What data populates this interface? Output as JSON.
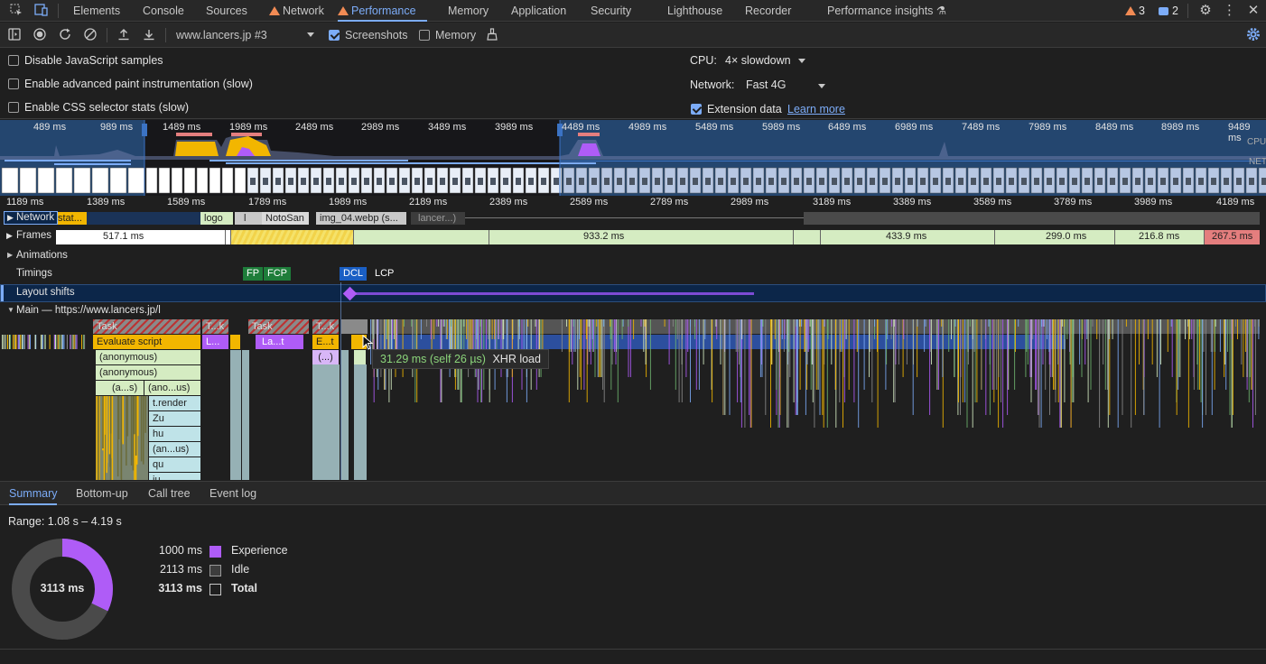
{
  "tabs": {
    "elements": "Elements",
    "console": "Console",
    "sources": "Sources",
    "network": "Network",
    "performance": "Performance",
    "memory": "Memory",
    "application": "Application",
    "security": "Security",
    "lighthouse": "Lighthouse",
    "recorder": "Recorder",
    "performance_insights": "Performance insights",
    "warnings_count": "3",
    "messages_count": "2"
  },
  "toolbar": {
    "recording_select": "www.lancers.jp #3",
    "screenshots_label": "Screenshots",
    "screenshots_checked": true,
    "memory_label": "Memory",
    "memory_checked": false
  },
  "settings": {
    "disable_js_samples": "Disable JavaScript samples",
    "advanced_paint": "Enable advanced paint instrumentation (slow)",
    "css_selector_stats": "Enable CSS selector stats (slow)",
    "cpu_label": "CPU:",
    "cpu_value": "4× slowdown",
    "network_label": "Network:",
    "network_value": "Fast 4G",
    "extension_data": "Extension data",
    "learn_more": "Learn more"
  },
  "overview": {
    "ticks": [
      "489 ms",
      "989 ms",
      "1489 ms",
      "1989 ms",
      "2489 ms",
      "2989 ms",
      "3489 ms",
      "3989 ms",
      "4489 ms",
      "4989 ms",
      "5489 ms",
      "5989 ms",
      "6489 ms",
      "6989 ms",
      "7489 ms",
      "7989 ms",
      "8489 ms",
      "8989 ms",
      "9489 ms"
    ],
    "cpu_label": "CPU",
    "net_label": "NET"
  },
  "ruler": {
    "ticks": [
      "1189 ms",
      "1389 ms",
      "1589 ms",
      "1789 ms",
      "1989 ms",
      "2189 ms",
      "2389 ms",
      "2589 ms",
      "2789 ms",
      "2989 ms",
      "3189 ms",
      "3389 ms",
      "3589 ms",
      "3789 ms",
      "3989 ms",
      "4189 ms"
    ]
  },
  "tracks": {
    "network": "Network",
    "network_items": [
      "stat...",
      "logo",
      "l",
      "NotoSan",
      "img_04.webp (s...",
      "lancer...)"
    ],
    "frames": "Frames",
    "frame_durations": [
      "517.1 ms",
      "933.2 ms",
      "433.9 ms",
      "299.0 ms",
      "216.8 ms",
      "267.5 ms"
    ],
    "animations": "Animations",
    "timings": "Timings",
    "timing_markers": [
      "FP",
      "FCP",
      "DCL",
      "LCP"
    ],
    "layout_shifts": "Layout shifts",
    "main": "Main — https://www.lancers.jp/l"
  },
  "flame": {
    "task": "Task",
    "t_k": "T...k",
    "t_k2": "T...k",
    "evaluate_script": "Evaluate script",
    "l_short": "L...",
    "la_t": "La...t",
    "e_t": "E...t",
    "anon1": "(anonymous)",
    "anon2": "(anonymous)",
    "anon_paren": "(...)",
    "a_s": "(a...s)",
    "ano_us": "(ano...us)",
    "t_render": "t.render",
    "zu": "Zu",
    "hu": "hu",
    "an_us": "(an...us)",
    "qu": "qu",
    "iu": "iu"
  },
  "tooltip": {
    "time": "31.29 ms (self 26 µs)",
    "label": "XHR load"
  },
  "bottom_tabs": {
    "summary": "Summary",
    "bottom_up": "Bottom-up",
    "call_tree": "Call tree",
    "event_log": "Event log"
  },
  "summary": {
    "range": "Range: 1.08 s – 4.19 s",
    "total_center": "3113 ms",
    "rows": [
      {
        "value": "1000 ms",
        "name": "Experience",
        "color": "#af5cf7"
      },
      {
        "value": "2113 ms",
        "name": "Idle",
        "color": "#3d3d3d"
      },
      {
        "value": "3113 ms",
        "name": "Total",
        "color": "#1f1f1f"
      }
    ],
    "experience_fraction": 0.3212
  },
  "colors": {
    "accent": "#7cacf8",
    "scripting": "#f2b600",
    "rendering": "#af5cf7",
    "frames_green": "#d5ecc2",
    "frames_red": "#e47e7e"
  }
}
